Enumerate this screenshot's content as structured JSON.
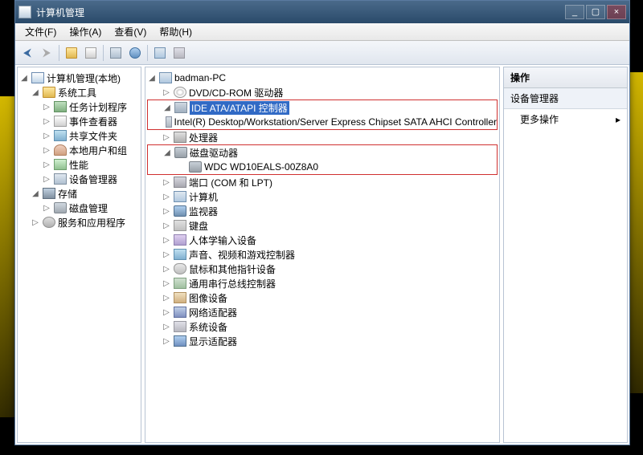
{
  "window": {
    "title": "计算机管理",
    "buttons": {
      "min": "_",
      "max": "▢",
      "close": "×"
    }
  },
  "menubar": [
    "文件(F)",
    "操作(A)",
    "查看(V)",
    "帮助(H)"
  ],
  "left_tree": {
    "root": "计算机管理(本地)",
    "groups": [
      {
        "label": "系统工具",
        "icon": "ic-folder",
        "expanded": true,
        "children": [
          {
            "label": "任务计划程序",
            "icon": "ic-task"
          },
          {
            "label": "事件查看器",
            "icon": "ic-event"
          },
          {
            "label": "共享文件夹",
            "icon": "ic-share"
          },
          {
            "label": "本地用户和组",
            "icon": "ic-user"
          },
          {
            "label": "性能",
            "icon": "ic-perf"
          },
          {
            "label": "设备管理器",
            "icon": "ic-devmgr"
          }
        ]
      },
      {
        "label": "存储",
        "icon": "ic-storage",
        "expanded": true,
        "children": [
          {
            "label": "磁盘管理",
            "icon": "ic-disk"
          }
        ]
      },
      {
        "label": "服务和应用程序",
        "icon": "ic-service",
        "expanded": false,
        "children": []
      }
    ]
  },
  "center_tree": {
    "root": "badman-PC",
    "items": [
      {
        "label": "DVD/CD-ROM 驱动器",
        "icon": "ic-dvd",
        "toggle": "▷",
        "indent": 1
      },
      {
        "label": "IDE ATA/ATAPI 控制器",
        "icon": "ic-ide",
        "toggle": "◢",
        "indent": 1,
        "highlight": true,
        "redbox": "start"
      },
      {
        "label": "Intel(R) Desktop/Workstation/Server Express Chipset SATA AHCI Controller",
        "icon": "ic-chip",
        "toggle": "",
        "indent": 2,
        "redbox": "end"
      },
      {
        "label": "处理器",
        "icon": "ic-cpu",
        "toggle": "▷",
        "indent": 1
      },
      {
        "label": "磁盘驱动器",
        "icon": "ic-hdd",
        "toggle": "◢",
        "indent": 1,
        "redbox": "start"
      },
      {
        "label": "WDC WD10EALS-00Z8A0",
        "icon": "ic-hdd",
        "toggle": "",
        "indent": 2,
        "redbox": "end"
      },
      {
        "label": "端口 (COM 和 LPT)",
        "icon": "ic-port",
        "toggle": "▷",
        "indent": 1
      },
      {
        "label": "计算机",
        "icon": "ic-pc",
        "toggle": "▷",
        "indent": 1
      },
      {
        "label": "监视器",
        "icon": "ic-monitor",
        "toggle": "▷",
        "indent": 1
      },
      {
        "label": "键盘",
        "icon": "ic-kbd",
        "toggle": "▷",
        "indent": 1
      },
      {
        "label": "人体学输入设备",
        "icon": "ic-hid",
        "toggle": "▷",
        "indent": 1
      },
      {
        "label": "声音、视频和游戏控制器",
        "icon": "ic-audio",
        "toggle": "▷",
        "indent": 1
      },
      {
        "label": "鼠标和其他指针设备",
        "icon": "ic-mouse",
        "toggle": "▷",
        "indent": 1
      },
      {
        "label": "通用串行总线控制器",
        "icon": "ic-usb",
        "toggle": "▷",
        "indent": 1
      },
      {
        "label": "图像设备",
        "icon": "ic-img",
        "toggle": "▷",
        "indent": 1
      },
      {
        "label": "网络适配器",
        "icon": "ic-net",
        "toggle": "▷",
        "indent": 1
      },
      {
        "label": "系统设备",
        "icon": "ic-sys",
        "toggle": "▷",
        "indent": 1
      },
      {
        "label": "显示适配器",
        "icon": "ic-display",
        "toggle": "▷",
        "indent": 1
      }
    ]
  },
  "actions": {
    "header": "操作",
    "section": "设备管理器",
    "more": "更多操作",
    "arrow": "▸"
  }
}
